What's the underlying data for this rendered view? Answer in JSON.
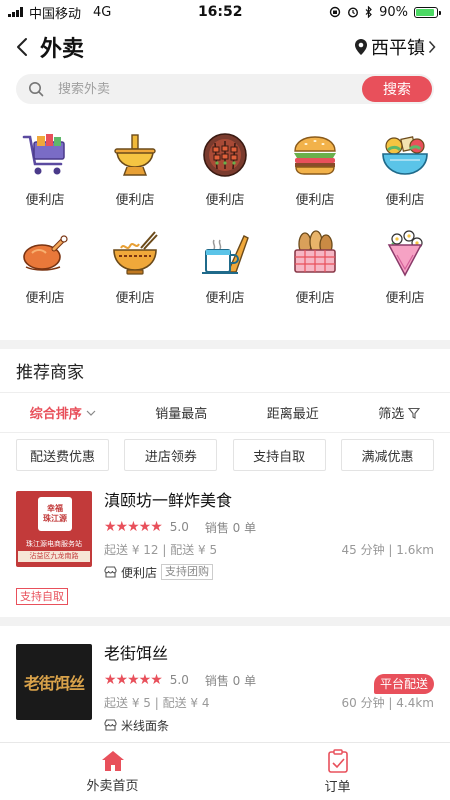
{
  "status_bar": {
    "carrier": "中国移动",
    "network": "4G",
    "time": "16:52",
    "battery": "90%",
    "battery_level": 0.9,
    "battery_color": "#4cd964"
  },
  "header": {
    "title": "外卖",
    "location": "西平镇",
    "back_icon": "chevron-left-icon",
    "location_icon": "location-pin-icon"
  },
  "search": {
    "placeholder": "搜索外卖",
    "button_label": "搜索",
    "accent": "#e8505b"
  },
  "categories": [
    {
      "label": "便利店",
      "icon": "shopping-cart-icon"
    },
    {
      "label": "便利店",
      "icon": "hotpot-icon"
    },
    {
      "label": "便利店",
      "icon": "skewers-plate-icon"
    },
    {
      "label": "便利店",
      "icon": "burger-icon"
    },
    {
      "label": "便利店",
      "icon": "salad-bowl-icon"
    },
    {
      "label": "便利店",
      "icon": "roast-chicken-icon"
    },
    {
      "label": "便利店",
      "icon": "noodle-bowl-icon"
    },
    {
      "label": "便利店",
      "icon": "tea-cup-icon"
    },
    {
      "label": "便利店",
      "icon": "bread-basket-icon"
    },
    {
      "label": "便利店",
      "icon": "flower-bouquet-icon"
    }
  ],
  "recommend": {
    "title": "推荐商家",
    "sort_options": [
      "综合排序",
      "销量最高",
      "距离最近",
      "筛选"
    ],
    "filter_chips": [
      "配送费优惠",
      "进店领券",
      "支持自取",
      "满减优惠"
    ]
  },
  "shops": [
    {
      "name": "滇颐坊一鲜炸美食",
      "rating": "5.0",
      "stars": 5,
      "sales": "销售 0 单",
      "price": "起送 ¥ 12 | 配送 ¥ 5",
      "delivery": "45 分钟 | 1.6km",
      "category": "便利店",
      "group_tag": "支持团购",
      "pickup_tag": "支持自取",
      "logo_text": [
        "幸福",
        "珠江源",
        "珠江源电商服务站",
        "沾益区九龙南路"
      ]
    },
    {
      "name": "老街饵丝",
      "rating": "5.0",
      "stars": 5,
      "sales": "销售 0 单",
      "price": "起送 ¥ 5 | 配送 ¥ 4",
      "delivery": "60 分钟 | 4.4km",
      "category": "米线面条",
      "badge": "平台配送",
      "logo_text": [
        "老街饵丝"
      ]
    }
  ],
  "bottom_nav": [
    {
      "label": "外卖首页",
      "icon": "home-icon",
      "active": true
    },
    {
      "label": "订单",
      "icon": "order-clipboard-icon",
      "active": false
    }
  ]
}
